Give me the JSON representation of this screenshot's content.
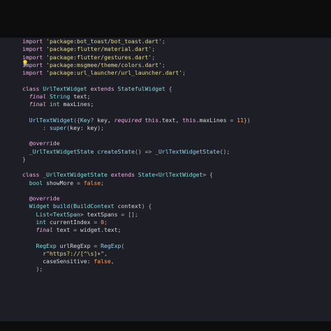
{
  "editor": {
    "background": "#1e1f26",
    "colors": {
      "keyword": "#f3a9e6",
      "string": "#e6d98b",
      "type": "#7fdde0",
      "function": "#8fd4f2",
      "number": "#ff9e64",
      "identifier": "#d7dae0"
    },
    "gutter_icon": "lightbulb-icon",
    "lines": [
      [
        [
          "kw",
          "import "
        ],
        [
          "str",
          "'package:bot_toast/bot_toast.dart'"
        ],
        [
          "pn",
          ";"
        ]
      ],
      [
        [
          "kw",
          "import "
        ],
        [
          "str",
          "'package:flutter/material.dart'"
        ],
        [
          "pn",
          ";"
        ]
      ],
      [
        [
          "kw",
          "import "
        ],
        [
          "str",
          "'package:flutter/gestures.dart'"
        ],
        [
          "pn",
          ";"
        ]
      ],
      [
        [
          "kw",
          "import "
        ],
        [
          "str",
          "'package:msgmee/theme/colors.dart'"
        ],
        [
          "pn",
          ";"
        ]
      ],
      [
        [
          "kw",
          "import "
        ],
        [
          "str",
          "'package:url_launcher/url_launcher.dart'"
        ],
        [
          "pn",
          ";"
        ]
      ],
      [],
      [
        [
          "kw",
          "class "
        ],
        [
          "ty",
          "UrlTextWidget "
        ],
        [
          "kw",
          "extends "
        ],
        [
          "ty",
          "StatefulWidget "
        ],
        [
          "pn",
          "{"
        ]
      ],
      [
        [
          "id",
          "  "
        ],
        [
          "kw-i",
          "final "
        ],
        [
          "ty",
          "String "
        ],
        [
          "id",
          "text;"
        ]
      ],
      [
        [
          "id",
          "  "
        ],
        [
          "kw-i",
          "final "
        ],
        [
          "ty",
          "int "
        ],
        [
          "id",
          "maxLines;"
        ]
      ],
      [],
      [
        [
          "id",
          "  "
        ],
        [
          "fn",
          "UrlTextWidget"
        ],
        [
          "pn",
          "({"
        ],
        [
          "ty",
          "Key"
        ],
        [
          "pn",
          "? "
        ],
        [
          "id",
          "key, "
        ],
        [
          "kw-i",
          "required "
        ],
        [
          "kw",
          "this"
        ],
        [
          "id",
          ".text, "
        ],
        [
          "kw",
          "this"
        ],
        [
          "id",
          ".maxLines "
        ],
        [
          "pn",
          "= "
        ],
        [
          "num",
          "11"
        ],
        [
          "pn",
          "})"
        ]
      ],
      [
        [
          "id",
          "      "
        ],
        [
          "pn",
          ": "
        ],
        [
          "fn",
          "super"
        ],
        [
          "pn",
          "("
        ],
        [
          "id",
          "key: key"
        ],
        [
          "pn",
          ");"
        ]
      ],
      [],
      [
        [
          "id",
          "  "
        ],
        [
          "ann",
          "@override"
        ]
      ],
      [
        [
          "id",
          "  "
        ],
        [
          "ty",
          "_UrlTextWidgetState "
        ],
        [
          "fn",
          "createState"
        ],
        [
          "pn",
          "() => "
        ],
        [
          "fn",
          "_UrlTextWidgetState"
        ],
        [
          "pn",
          "();"
        ]
      ],
      [
        [
          "pn",
          "}"
        ]
      ],
      [],
      [
        [
          "kw",
          "class "
        ],
        [
          "ty",
          "_UrlTextWidgetState "
        ],
        [
          "kw",
          "extends "
        ],
        [
          "ty",
          "State"
        ],
        [
          "pn",
          "<"
        ],
        [
          "ty",
          "UrlTextWidget"
        ],
        [
          "pn",
          "> {"
        ]
      ],
      [
        [
          "id",
          "  "
        ],
        [
          "ty",
          "bool "
        ],
        [
          "id",
          "showMore "
        ],
        [
          "pn",
          "= "
        ],
        [
          "bool",
          "false"
        ],
        [
          "pn",
          ";"
        ]
      ],
      [],
      [
        [
          "id",
          "  "
        ],
        [
          "ann",
          "@override"
        ]
      ],
      [
        [
          "id",
          "  "
        ],
        [
          "ty",
          "Widget "
        ],
        [
          "fn",
          "build"
        ],
        [
          "pn",
          "("
        ],
        [
          "ty",
          "BuildContext "
        ],
        [
          "id",
          "context"
        ],
        [
          "pn",
          ") {"
        ]
      ],
      [
        [
          "id",
          "    "
        ],
        [
          "ty",
          "List"
        ],
        [
          "pn",
          "<"
        ],
        [
          "ty",
          "TextSpan"
        ],
        [
          "pn",
          "> "
        ],
        [
          "id",
          "textSpans "
        ],
        [
          "pn",
          "= [];"
        ]
      ],
      [
        [
          "id",
          "    "
        ],
        [
          "ty",
          "int "
        ],
        [
          "id",
          "currentIndex "
        ],
        [
          "pn",
          "= "
        ],
        [
          "num",
          "0"
        ],
        [
          "pn",
          ";"
        ]
      ],
      [
        [
          "id",
          "    "
        ],
        [
          "kw-i",
          "final "
        ],
        [
          "id",
          "text "
        ],
        [
          "pn",
          "= "
        ],
        [
          "id",
          "widget.text;"
        ]
      ],
      [],
      [
        [
          "id",
          "    "
        ],
        [
          "ty",
          "RegExp "
        ],
        [
          "id",
          "urlRegExp "
        ],
        [
          "pn",
          "= "
        ],
        [
          "fn",
          "RegExp"
        ],
        [
          "pn",
          "("
        ]
      ],
      [
        [
          "id",
          "      "
        ],
        [
          "str",
          "r\"https?://[^\\s]+\""
        ],
        [
          "pn",
          ","
        ]
      ],
      [
        [
          "id",
          "      "
        ],
        [
          "id",
          "caseSensitive: "
        ],
        [
          "bool",
          "false"
        ],
        [
          "pn",
          ","
        ]
      ],
      [
        [
          "id",
          "    "
        ],
        [
          "pn",
          ");"
        ]
      ]
    ]
  }
}
